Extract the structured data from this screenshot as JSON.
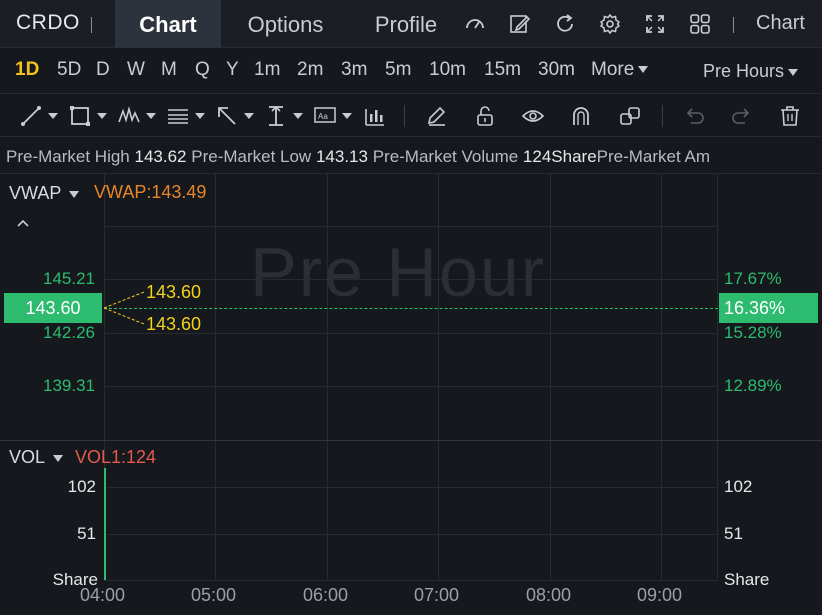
{
  "header": {
    "ticker": "CRDO",
    "tabs": [
      {
        "label": "Chart",
        "active": true
      },
      {
        "label": "Options",
        "active": false
      },
      {
        "label": "Profile",
        "active": false
      }
    ],
    "chart_menu_label": "Chart"
  },
  "timeframes": {
    "items": [
      "1D",
      "5D",
      "D",
      "W",
      "M",
      "Q",
      "Y",
      "1m",
      "2m",
      "3m",
      "5m",
      "10m",
      "15m",
      "30m"
    ],
    "active": "1D",
    "more_label": "More",
    "session_label": "Pre Hours"
  },
  "info_line": {
    "high_label": "Pre-Market High",
    "high_value": "143.62",
    "low_label": "Pre-Market Low",
    "low_value": "143.13",
    "volume_label": "Pre-Market Volume",
    "volume_value": "124Share",
    "amount_label": "Pre-Market Am"
  },
  "price_pane": {
    "indicator": "VWAP",
    "indicator_value": "VWAP:143.49",
    "watermark": "Pre Hour",
    "left_ticks": [
      "145.21",
      "142.26",
      "139.31"
    ],
    "right_ticks": [
      "17.67%",
      "15.28%",
      "12.89%"
    ],
    "current_price": "143.60",
    "current_pct": "16.36%",
    "callout_high": "143.60",
    "callout_low": "143.60"
  },
  "volume_pane": {
    "indicator": "VOL",
    "indicator_value": "VOL1:124",
    "left_ticks": [
      "102",
      "51",
      "Share"
    ],
    "right_ticks": [
      "102",
      "51",
      "Share"
    ]
  },
  "x_axis": [
    "04:00",
    "05:00",
    "06:00",
    "07:00",
    "08:00",
    "09:00"
  ],
  "colors": {
    "background": "#15181d",
    "up_green": "#2dbb6f",
    "accent_yellow": "#f3c21b",
    "vwap_orange": "#e8852a",
    "vol_red": "#e35a4f"
  },
  "icons": {
    "nav": [
      "speedometer-icon",
      "edit-icon",
      "refresh-icon",
      "settings-icon",
      "fullscreen-icon",
      "grid-layout-icon"
    ],
    "tools": [
      "trend-line-icon",
      "rectangle-icon",
      "pattern-icon",
      "fib-icon",
      "arrow-icon",
      "price-range-icon",
      "text-icon",
      "bar-pattern-icon",
      "pencil-icon",
      "lock-icon",
      "eye-icon",
      "magnet-icon",
      "link-icon",
      "undo-icon",
      "redo-icon",
      "trash-icon"
    ]
  }
}
